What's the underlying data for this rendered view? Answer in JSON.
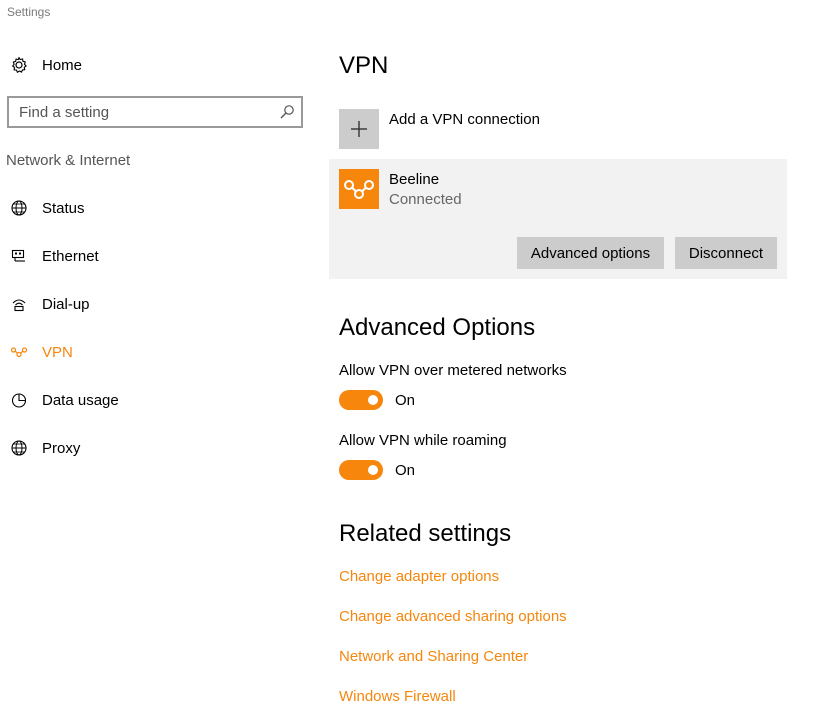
{
  "app": {
    "title": "Settings"
  },
  "sidebar": {
    "home_label": "Home",
    "search": {
      "placeholder": "Find a setting",
      "value": ""
    },
    "section_label": "Network & Internet",
    "items": [
      {
        "label": "Status",
        "icon": "globe-icon",
        "active": false
      },
      {
        "label": "Ethernet",
        "icon": "ethernet-icon",
        "active": false
      },
      {
        "label": "Dial-up",
        "icon": "dialup-icon",
        "active": false
      },
      {
        "label": "VPN",
        "icon": "vpn-icon",
        "active": true
      },
      {
        "label": "Data usage",
        "icon": "data-usage-icon",
        "active": false
      },
      {
        "label": "Proxy",
        "icon": "globe-icon",
        "active": false
      }
    ]
  },
  "main": {
    "title": "VPN",
    "add_vpn_label": "Add a VPN connection",
    "connection": {
      "name": "Beeline",
      "status": "Connected",
      "advanced_button": "Advanced options",
      "disconnect_button": "Disconnect"
    },
    "advanced": {
      "heading": "Advanced Options",
      "options": [
        {
          "label": "Allow VPN over metered networks",
          "state": "On"
        },
        {
          "label": "Allow VPN while roaming",
          "state": "On"
        }
      ]
    },
    "related": {
      "heading": "Related settings",
      "links": [
        "Change adapter options",
        "Change advanced sharing options",
        "Network and Sharing Center",
        "Windows Firewall"
      ]
    }
  },
  "colors": {
    "accent": "#f7860c",
    "card_bg": "#f2f2f2",
    "button_bg": "#cccccc",
    "secondary_text": "#666666"
  }
}
